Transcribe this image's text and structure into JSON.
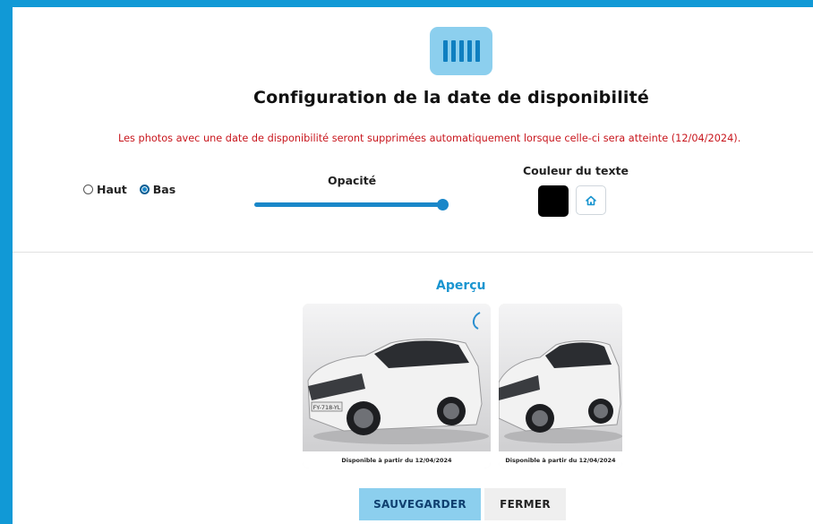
{
  "header": {
    "title": "Configuration de la date de disponibilité",
    "logo_icon": "barcode-icon"
  },
  "warning": "Les photos avec une date de disponibilité seront supprimées automatiquement lorsque celle-ci sera atteinte (12/04/2024).",
  "position": {
    "options": [
      {
        "label": "Haut",
        "selected": false
      },
      {
        "label": "Bas",
        "selected": true
      }
    ]
  },
  "opacity": {
    "label": "Opacité",
    "value_percent": 100
  },
  "text_color": {
    "label": "Couleur du texte",
    "value": "#000000",
    "reset_icon": "home-icon"
  },
  "preview": {
    "label": "Aperçu",
    "cards": [
      {
        "caption": "Disponible à partir du 12/04/2024",
        "plate": "FY-718-YL"
      },
      {
        "caption": "Disponible à partir du 12/04/2024"
      }
    ]
  },
  "buttons": {
    "save": "SAUVEGARDER",
    "close": "FERMER"
  },
  "colors": {
    "accent": "#1199d6",
    "light_accent": "#8ccfee",
    "warning": "#c8161d"
  }
}
